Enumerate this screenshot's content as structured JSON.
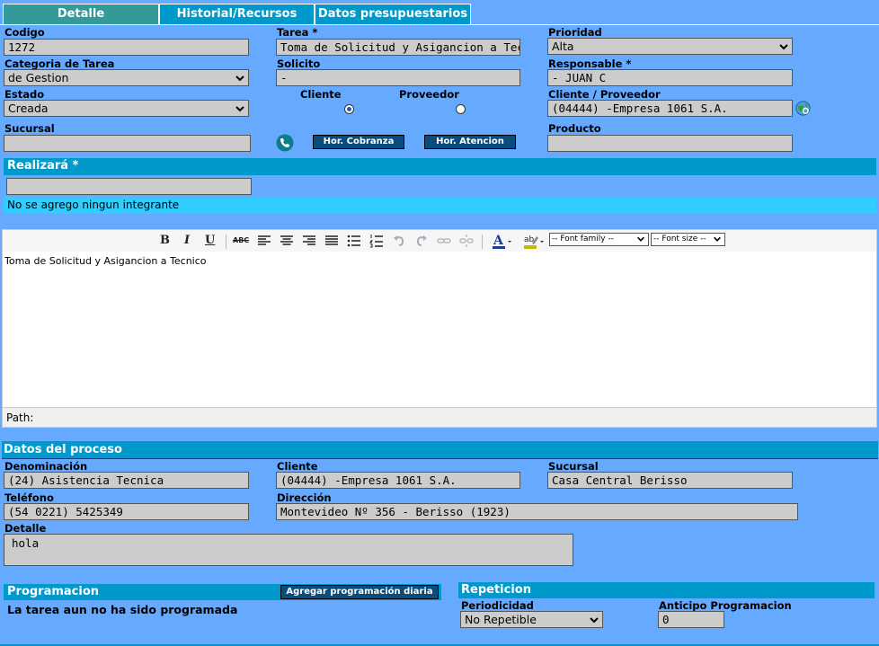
{
  "tabs": [
    "Detalle",
    "Historial/Recursos",
    "Datos presupuestarios"
  ],
  "form": {
    "codigo_label": "Codigo",
    "codigo_value": "1272",
    "tarea_label": "Tarea *",
    "tarea_value": "Toma de Solicitud y Asigancion a Tecnico",
    "prioridad_label": "Prioridad",
    "prioridad_value": "Alta",
    "categoria_label": "Categoria de Tarea",
    "categoria_value": "de Gestion",
    "solicito_label": "Solicito",
    "solicito_value": "-",
    "responsable_label": "Responsable *",
    "responsable_value": "- JUAN C",
    "estado_label": "Estado",
    "estado_value": "Creada",
    "cliente_radio_label": "Cliente",
    "proveedor_radio_label": "Proveedor",
    "cliente_proveedor_label": "Cliente / Proveedor",
    "cliente_proveedor_value": "(04444) -Empresa 1061 S.A.",
    "sucursal_label": "Sucursal",
    "sucursal_value": "",
    "producto_label": "Producto",
    "producto_value": "",
    "hor_cobranza": "Hor. Cobranza",
    "hor_atencion": "Hor. Atencion"
  },
  "realizara": {
    "header": "Realizará *",
    "input_value": "",
    "empty_msg": "No se agrego ningun integrante"
  },
  "editor": {
    "font_family_placeholder": "-- Font family --",
    "font_size_placeholder": "-- Font size --",
    "content": "Toma de Solicitud y Asigancion a Tecnico",
    "path_label": "Path:"
  },
  "proceso": {
    "header": "Datos del proceso",
    "denominacion_label": "Denominación",
    "denominacion_value": "(24) Asistencia Tecnica",
    "cliente_label": "Cliente",
    "cliente_value": "(04444) -Empresa 1061 S.A.",
    "sucursal_label": "Sucursal",
    "sucursal_value": "Casa Central Berisso",
    "telefono_label": "Teléfono",
    "telefono_value": "(54 0221) 5425349",
    "direccion_label": "Dirección",
    "direccion_value": "Montevideo Nº 356 - Berisso (1923)",
    "detalle_label": "Detalle",
    "detalle_value": "hola"
  },
  "programacion": {
    "header": "Programacion",
    "add_button": "Agregar programación diaria",
    "status": "La tarea aun no ha sido programada"
  },
  "repeticion": {
    "header": "Repeticion",
    "periodicidad_label": "Periodicidad",
    "periodicidad_value": "No Repetible",
    "anticipo_label": "Anticipo Programacion",
    "anticipo_value": "0"
  },
  "colors": {
    "background": "#66aaff",
    "section_bar": "#0099cc",
    "active_tab": "#339999",
    "button": "#0a4c7e"
  }
}
